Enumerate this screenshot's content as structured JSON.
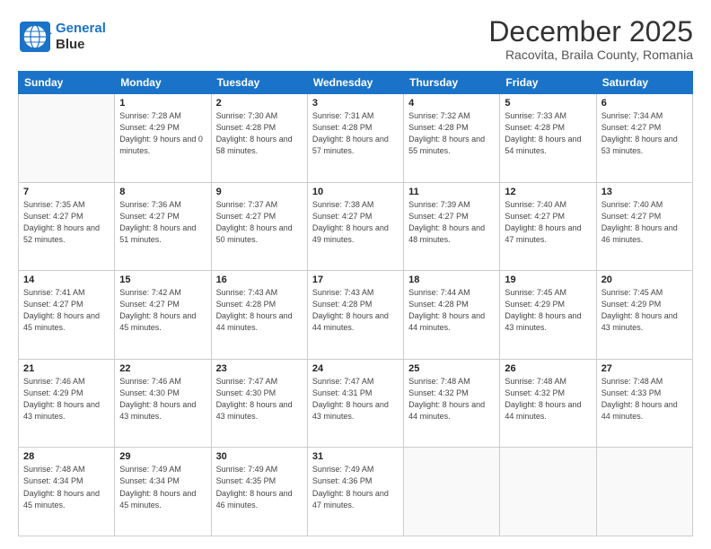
{
  "logo": {
    "line1": "General",
    "line2": "Blue"
  },
  "title": "December 2025",
  "subtitle": "Racovita, Braila County, Romania",
  "weekdays": [
    "Sunday",
    "Monday",
    "Tuesday",
    "Wednesday",
    "Thursday",
    "Friday",
    "Saturday"
  ],
  "weeks": [
    [
      {
        "day": "",
        "sunrise": "",
        "sunset": "",
        "daylight": ""
      },
      {
        "day": "1",
        "sunrise": "Sunrise: 7:28 AM",
        "sunset": "Sunset: 4:29 PM",
        "daylight": "Daylight: 9 hours and 0 minutes."
      },
      {
        "day": "2",
        "sunrise": "Sunrise: 7:30 AM",
        "sunset": "Sunset: 4:28 PM",
        "daylight": "Daylight: 8 hours and 58 minutes."
      },
      {
        "day": "3",
        "sunrise": "Sunrise: 7:31 AM",
        "sunset": "Sunset: 4:28 PM",
        "daylight": "Daylight: 8 hours and 57 minutes."
      },
      {
        "day": "4",
        "sunrise": "Sunrise: 7:32 AM",
        "sunset": "Sunset: 4:28 PM",
        "daylight": "Daylight: 8 hours and 55 minutes."
      },
      {
        "day": "5",
        "sunrise": "Sunrise: 7:33 AM",
        "sunset": "Sunset: 4:28 PM",
        "daylight": "Daylight: 8 hours and 54 minutes."
      },
      {
        "day": "6",
        "sunrise": "Sunrise: 7:34 AM",
        "sunset": "Sunset: 4:27 PM",
        "daylight": "Daylight: 8 hours and 53 minutes."
      }
    ],
    [
      {
        "day": "7",
        "sunrise": "Sunrise: 7:35 AM",
        "sunset": "Sunset: 4:27 PM",
        "daylight": "Daylight: 8 hours and 52 minutes."
      },
      {
        "day": "8",
        "sunrise": "Sunrise: 7:36 AM",
        "sunset": "Sunset: 4:27 PM",
        "daylight": "Daylight: 8 hours and 51 minutes."
      },
      {
        "day": "9",
        "sunrise": "Sunrise: 7:37 AM",
        "sunset": "Sunset: 4:27 PM",
        "daylight": "Daylight: 8 hours and 50 minutes."
      },
      {
        "day": "10",
        "sunrise": "Sunrise: 7:38 AM",
        "sunset": "Sunset: 4:27 PM",
        "daylight": "Daylight: 8 hours and 49 minutes."
      },
      {
        "day": "11",
        "sunrise": "Sunrise: 7:39 AM",
        "sunset": "Sunset: 4:27 PM",
        "daylight": "Daylight: 8 hours and 48 minutes."
      },
      {
        "day": "12",
        "sunrise": "Sunrise: 7:40 AM",
        "sunset": "Sunset: 4:27 PM",
        "daylight": "Daylight: 8 hours and 47 minutes."
      },
      {
        "day": "13",
        "sunrise": "Sunrise: 7:40 AM",
        "sunset": "Sunset: 4:27 PM",
        "daylight": "Daylight: 8 hours and 46 minutes."
      }
    ],
    [
      {
        "day": "14",
        "sunrise": "Sunrise: 7:41 AM",
        "sunset": "Sunset: 4:27 PM",
        "daylight": "Daylight: 8 hours and 45 minutes."
      },
      {
        "day": "15",
        "sunrise": "Sunrise: 7:42 AM",
        "sunset": "Sunset: 4:27 PM",
        "daylight": "Daylight: 8 hours and 45 minutes."
      },
      {
        "day": "16",
        "sunrise": "Sunrise: 7:43 AM",
        "sunset": "Sunset: 4:28 PM",
        "daylight": "Daylight: 8 hours and 44 minutes."
      },
      {
        "day": "17",
        "sunrise": "Sunrise: 7:43 AM",
        "sunset": "Sunset: 4:28 PM",
        "daylight": "Daylight: 8 hours and 44 minutes."
      },
      {
        "day": "18",
        "sunrise": "Sunrise: 7:44 AM",
        "sunset": "Sunset: 4:28 PM",
        "daylight": "Daylight: 8 hours and 44 minutes."
      },
      {
        "day": "19",
        "sunrise": "Sunrise: 7:45 AM",
        "sunset": "Sunset: 4:29 PM",
        "daylight": "Daylight: 8 hours and 43 minutes."
      },
      {
        "day": "20",
        "sunrise": "Sunrise: 7:45 AM",
        "sunset": "Sunset: 4:29 PM",
        "daylight": "Daylight: 8 hours and 43 minutes."
      }
    ],
    [
      {
        "day": "21",
        "sunrise": "Sunrise: 7:46 AM",
        "sunset": "Sunset: 4:29 PM",
        "daylight": "Daylight: 8 hours and 43 minutes."
      },
      {
        "day": "22",
        "sunrise": "Sunrise: 7:46 AM",
        "sunset": "Sunset: 4:30 PM",
        "daylight": "Daylight: 8 hours and 43 minutes."
      },
      {
        "day": "23",
        "sunrise": "Sunrise: 7:47 AM",
        "sunset": "Sunset: 4:30 PM",
        "daylight": "Daylight: 8 hours and 43 minutes."
      },
      {
        "day": "24",
        "sunrise": "Sunrise: 7:47 AM",
        "sunset": "Sunset: 4:31 PM",
        "daylight": "Daylight: 8 hours and 43 minutes."
      },
      {
        "day": "25",
        "sunrise": "Sunrise: 7:48 AM",
        "sunset": "Sunset: 4:32 PM",
        "daylight": "Daylight: 8 hours and 44 minutes."
      },
      {
        "day": "26",
        "sunrise": "Sunrise: 7:48 AM",
        "sunset": "Sunset: 4:32 PM",
        "daylight": "Daylight: 8 hours and 44 minutes."
      },
      {
        "day": "27",
        "sunrise": "Sunrise: 7:48 AM",
        "sunset": "Sunset: 4:33 PM",
        "daylight": "Daylight: 8 hours and 44 minutes."
      }
    ],
    [
      {
        "day": "28",
        "sunrise": "Sunrise: 7:48 AM",
        "sunset": "Sunset: 4:34 PM",
        "daylight": "Daylight: 8 hours and 45 minutes."
      },
      {
        "day": "29",
        "sunrise": "Sunrise: 7:49 AM",
        "sunset": "Sunset: 4:34 PM",
        "daylight": "Daylight: 8 hours and 45 minutes."
      },
      {
        "day": "30",
        "sunrise": "Sunrise: 7:49 AM",
        "sunset": "Sunset: 4:35 PM",
        "daylight": "Daylight: 8 hours and 46 minutes."
      },
      {
        "day": "31",
        "sunrise": "Sunrise: 7:49 AM",
        "sunset": "Sunset: 4:36 PM",
        "daylight": "Daylight: 8 hours and 47 minutes."
      },
      {
        "day": "",
        "sunrise": "",
        "sunset": "",
        "daylight": ""
      },
      {
        "day": "",
        "sunrise": "",
        "sunset": "",
        "daylight": ""
      },
      {
        "day": "",
        "sunrise": "",
        "sunset": "",
        "daylight": ""
      }
    ]
  ]
}
